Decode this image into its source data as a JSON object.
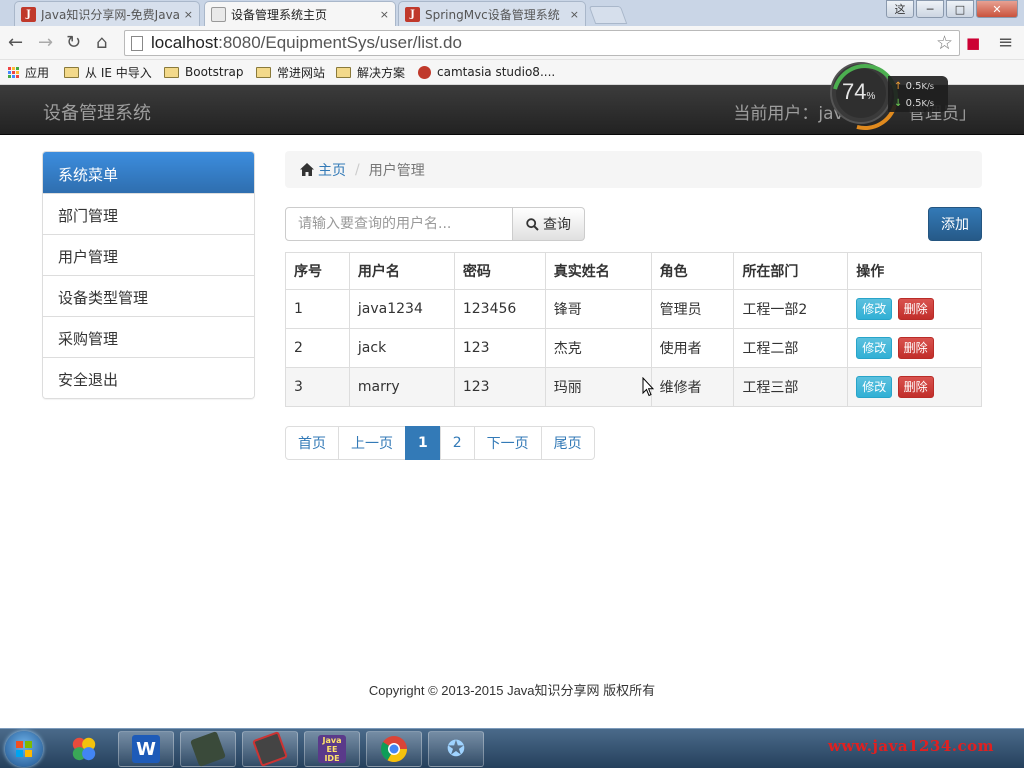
{
  "browser": {
    "tabs": [
      {
        "title": "Java知识分享网-免费Java",
        "close": "×"
      },
      {
        "title": "设备管理系统主页",
        "close": "×"
      },
      {
        "title": "SpringMvc设备管理系统",
        "close": "×"
      }
    ],
    "url_host": "localhost",
    "url_path": ":8080/EquipmentSys/user/list.do",
    "window_user_label": "这",
    "bookmarks": [
      "应用",
      "从 IE 中导入",
      "Bootstrap",
      "常进网站",
      "解决方案",
      "camtasia studio8...."
    ]
  },
  "speed_widget": {
    "percent": "74",
    "percent_sign": "%",
    "up": "0.5",
    "down": "0.5",
    "unit": "K/s"
  },
  "navbar": {
    "brand": "设备管理系统",
    "current_user": "当前用户：java",
    "current_user_tail": "管理员」"
  },
  "sidebar": {
    "header": "系统菜单",
    "items": [
      {
        "label": "部门管理"
      },
      {
        "label": "用户管理"
      },
      {
        "label": "设备类型管理"
      },
      {
        "label": "采购管理"
      },
      {
        "label": "安全退出"
      }
    ]
  },
  "breadcrumb": {
    "home": "主页",
    "separator": "/",
    "current": "用户管理"
  },
  "search": {
    "placeholder": "请输入要查询的用户名...",
    "button": "查询"
  },
  "add_button": "添加",
  "table": {
    "headers": [
      "序号",
      "用户名",
      "密码",
      "真实姓名",
      "角色",
      "所在部门",
      "操作"
    ],
    "rows": [
      {
        "no": "1",
        "username": "java1234",
        "password": "123456",
        "realname": "锋哥",
        "role": "管理员",
        "dept": "工程一部2"
      },
      {
        "no": "2",
        "username": "jack",
        "password": "123",
        "realname": "杰克",
        "role": "使用者",
        "dept": "工程二部"
      },
      {
        "no": "3",
        "username": "marry",
        "password": "123",
        "realname": "玛丽",
        "role": "维修者",
        "dept": "工程三部"
      }
    ],
    "edit_label": "修改",
    "delete_label": "删除"
  },
  "pagination": [
    "首页",
    "上一页",
    "1",
    "2",
    "下一页",
    "尾页"
  ],
  "pagination_active": "1",
  "footer": "Copyright © 2013-2015 Java知识分享网 版权所有",
  "taskbar": {
    "watermark": "www.java1234.com",
    "javaee_icon_text": "Java EE IDE"
  },
  "colors": {
    "primary": "#337ab7",
    "navbar": "#222222",
    "info": "#5bc0de",
    "danger": "#d9534f"
  }
}
